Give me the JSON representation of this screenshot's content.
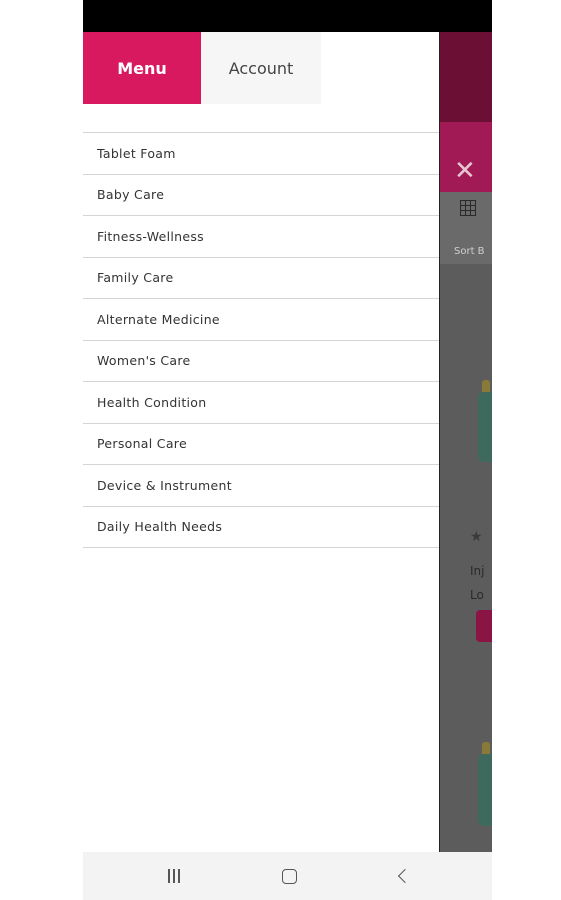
{
  "tabs": {
    "menu_label": "Menu",
    "account_label": "Account"
  },
  "menu": {
    "items": [
      {
        "label": "Tablet Foam"
      },
      {
        "label": "Baby Care"
      },
      {
        "label": "Fitness-Wellness"
      },
      {
        "label": "Family Care"
      },
      {
        "label": "Alternate Medicine"
      },
      {
        "label": "Women's Care"
      },
      {
        "label": "Health Condition"
      },
      {
        "label": "Personal Care"
      },
      {
        "label": "Device & Instrument"
      },
      {
        "label": "Daily Health Needs"
      }
    ]
  },
  "background": {
    "close_glyph": "✕",
    "sort_text": "Sort B",
    "star_glyph": "★",
    "text1": "Inj",
    "text2": "Lo"
  },
  "colors": {
    "accent": "#d9195f",
    "account_tab_bg": "#f6f6f6"
  },
  "icons": {
    "nav_recent": "recent-apps-icon",
    "nav_home": "home-icon",
    "nav_back": "back-icon",
    "grid": "grid-view-icon",
    "close": "close-icon"
  }
}
